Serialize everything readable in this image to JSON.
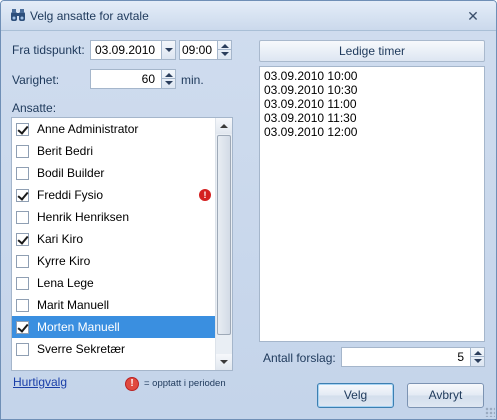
{
  "window": {
    "title": "Velg ansatte for avtale",
    "close_glyph": "✕",
    "icon": "binoculars-icon"
  },
  "form": {
    "from_label": "Fra tidspunkt:",
    "date_value": "03.09.2010",
    "time_value": "09:00",
    "duration_label": "Varighet:",
    "duration_value": "60",
    "duration_unit": "min.",
    "employees_label": "Ansatte:"
  },
  "employees": [
    {
      "name": "Anne Administrator",
      "checked": true,
      "busy": false,
      "selected": false
    },
    {
      "name": "Berit Bedri",
      "checked": false,
      "busy": false,
      "selected": false
    },
    {
      "name": "Bodil Builder",
      "checked": false,
      "busy": false,
      "selected": false
    },
    {
      "name": "Freddi Fysio",
      "checked": true,
      "busy": true,
      "selected": false
    },
    {
      "name": "Henrik Henriksen",
      "checked": false,
      "busy": false,
      "selected": false
    },
    {
      "name": "Kari Kiro",
      "checked": true,
      "busy": false,
      "selected": false
    },
    {
      "name": "Kyrre Kiro",
      "checked": false,
      "busy": false,
      "selected": false
    },
    {
      "name": "Lena Lege",
      "checked": false,
      "busy": false,
      "selected": false
    },
    {
      "name": "Marit Manuell",
      "checked": false,
      "busy": false,
      "selected": false
    },
    {
      "name": "Morten Manuell",
      "checked": true,
      "busy": false,
      "selected": true
    },
    {
      "name": "Sverre Sekretær",
      "checked": false,
      "busy": false,
      "selected": false
    }
  ],
  "busy_glyph": "!",
  "footer_left": {
    "quick_link": "Hurtigvalg",
    "legend_text": "= opptatt i perioden"
  },
  "available": {
    "header": "Ledige timer",
    "times": [
      "03.09.2010 10:00",
      "03.09.2010 10:30",
      "03.09.2010 11:00",
      "03.09.2010 11:30",
      "03.09.2010 12:00"
    ],
    "suggestions_label": "Antall forslag:",
    "suggestions_value": "5"
  },
  "buttons": {
    "ok_label": "Velg",
    "cancel_label": "Avbryt"
  },
  "colors": {
    "selection": "#3a8fe0",
    "busy_red": "#d42020",
    "link": "#1a3fa8"
  }
}
